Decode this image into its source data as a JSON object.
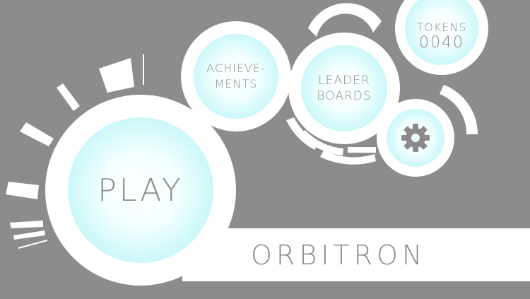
{
  "game": {
    "title": "ORBITRON"
  },
  "menu": {
    "play_label": "PLAY",
    "achievements_label": "ACHIEVE-\nMENTS",
    "leaderboards_label": "LEADER\nBOARDS",
    "tokens_label": "TOKENS",
    "tokens_count": "0040",
    "settings_icon": "gear-icon"
  },
  "colors": {
    "background": "#8c8c8c",
    "orb_ring": "#ffffff",
    "orb_glow": "#8feff2",
    "text": "#8c8c8c"
  }
}
